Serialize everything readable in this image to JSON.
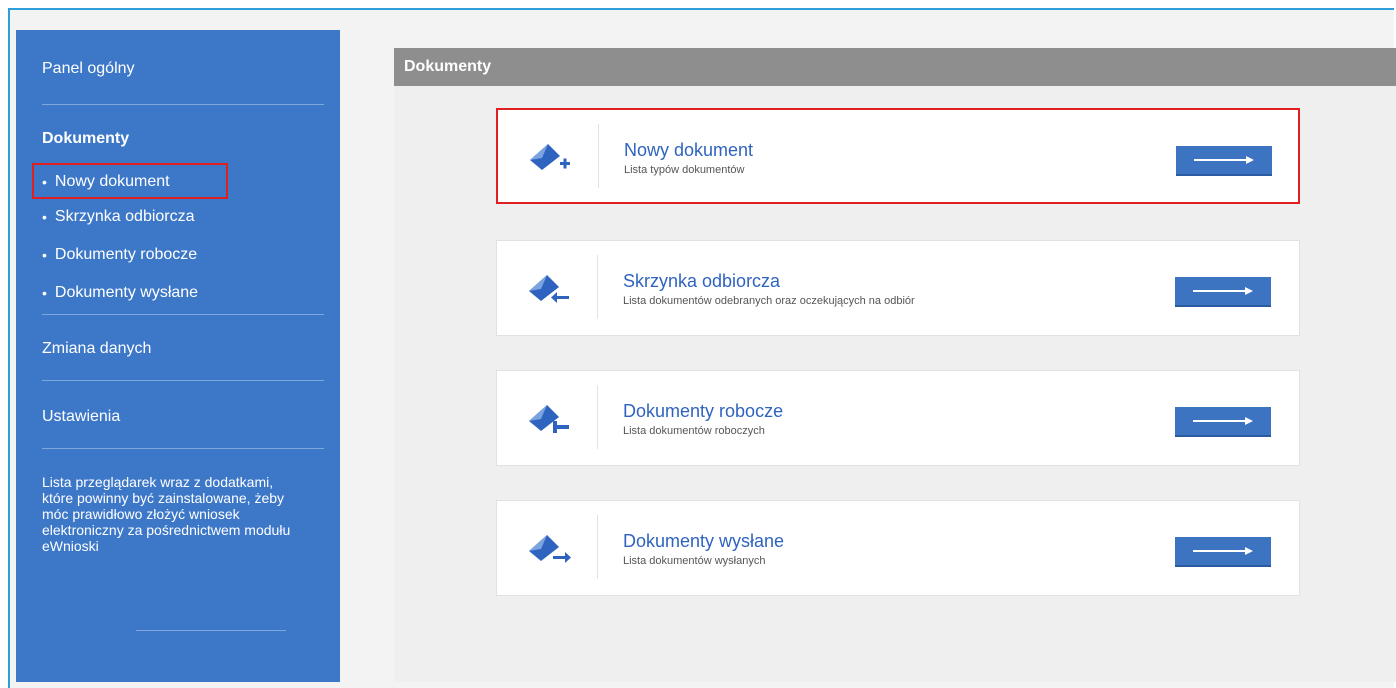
{
  "sidebar": {
    "panel": "Panel ogólny",
    "documents_heading": "Dokumenty",
    "items": [
      {
        "label": "Nowy dokument"
      },
      {
        "label": "Skrzynka odbiorcza"
      },
      {
        "label": "Dokumenty robocze"
      },
      {
        "label": "Dokumenty wysłane"
      }
    ],
    "change_data": "Zmiana danych",
    "settings": "Ustawienia",
    "info_text": "Lista przeglądarek wraz z dodatkami, które powinny być zainstalowane, żeby móc prawidłowo złożyć wniosek elektroniczny za pośrednictwem modułu eWnioski",
    "bullet": "•"
  },
  "panel": {
    "title": "Dokumenty",
    "cards": [
      {
        "title": "Nowy dokument",
        "subtitle": "Lista typów dokumentów",
        "icon": "envelope-plus-icon"
      },
      {
        "title": "Skrzynka odbiorcza",
        "subtitle": "Lista dokumentów odebranych oraz oczekujących na odbiór",
        "icon": "envelope-incoming-icon"
      },
      {
        "title": "Dokumenty robocze",
        "subtitle": "Lista dokumentów roboczych",
        "icon": "envelope-draft-icon"
      },
      {
        "title": "Dokumenty wysłane",
        "subtitle": "Lista dokumentów wysłanych",
        "icon": "envelope-sent-icon"
      }
    ]
  },
  "colors": {
    "sidebar_bg": "#3d78c8",
    "header_bg": "#8e8e8e",
    "accent": "#2f63c0",
    "highlight": "#e02020"
  }
}
